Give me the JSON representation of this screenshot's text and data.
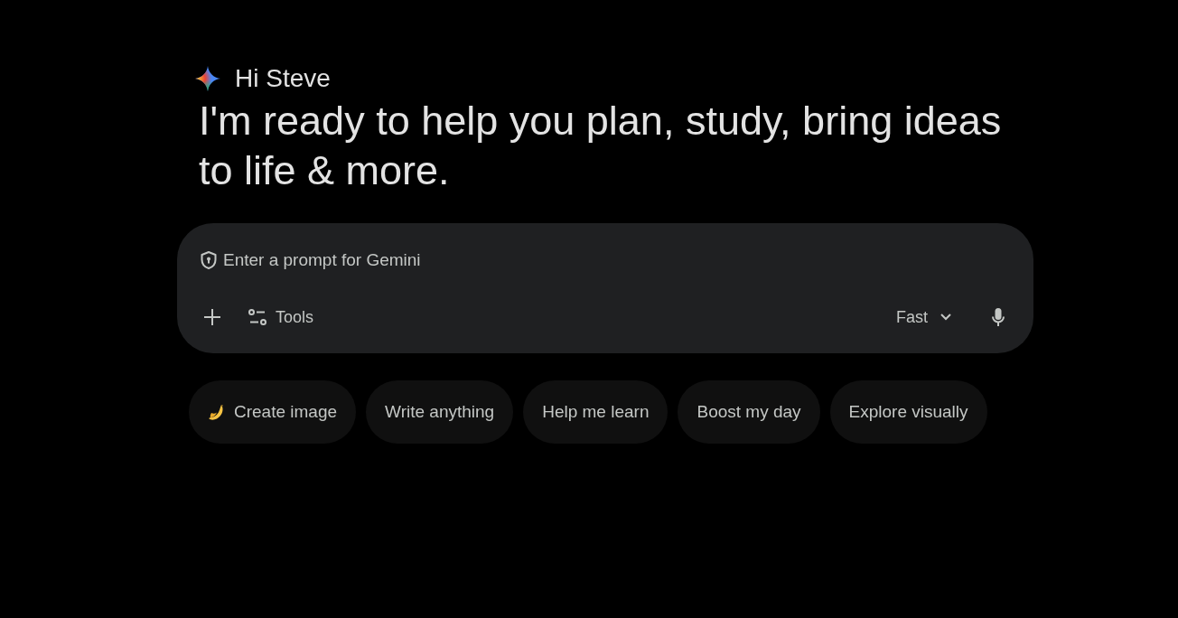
{
  "greeting": {
    "text": "Hi Steve"
  },
  "headline": "I'm ready to help you plan, study, bring ideas to life & more.",
  "prompt": {
    "placeholder": "Enter a prompt for Gemini"
  },
  "toolbar": {
    "tools_label": "Tools",
    "mode_label": "Fast"
  },
  "chips": [
    {
      "label": "Create image",
      "kind": "banana"
    },
    {
      "label": "Write anything",
      "kind": "plain"
    },
    {
      "label": "Help me learn",
      "kind": "plain"
    },
    {
      "label": "Boost my day",
      "kind": "plain"
    },
    {
      "label": "Explore visually",
      "kind": "plain"
    }
  ]
}
